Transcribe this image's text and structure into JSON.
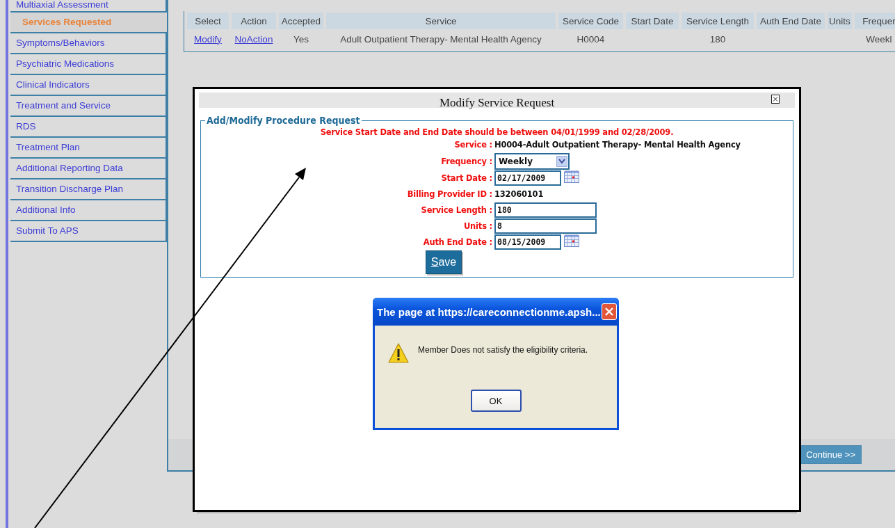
{
  "sidebar": {
    "items": [
      {
        "label": "Multiaxial Assessment",
        "selected": false
      },
      {
        "label": "Services Requested",
        "selected": true
      },
      {
        "label": "Symptoms/Behaviors",
        "selected": false
      },
      {
        "label": "Psychiatric Medications",
        "selected": false
      },
      {
        "label": "Clinical Indicators",
        "selected": false
      },
      {
        "label": "Treatment and Service",
        "selected": false
      },
      {
        "label": "RDS",
        "selected": false
      },
      {
        "label": "Treatment Plan",
        "selected": false
      },
      {
        "label": "Additional Reporting Data",
        "selected": false
      },
      {
        "label": "Transition Discharge Plan",
        "selected": false
      },
      {
        "label": "Additional Info",
        "selected": false
      },
      {
        "label": "Submit To APS",
        "selected": false
      }
    ]
  },
  "table": {
    "columns": [
      "Select",
      "Action",
      "Accepted",
      "Service",
      "Service Code",
      "Start Date",
      "Service Length",
      "Auth End Date",
      "Units",
      "Frequer"
    ],
    "rows": [
      {
        "cells": [
          {
            "text": "Modify",
            "kind": "link"
          },
          {
            "text": "NoAction",
            "kind": "link"
          },
          {
            "text": "Yes",
            "kind": "text"
          },
          {
            "text": "Adult Outpatient Therapy- Mental Health Agency",
            "kind": "text"
          },
          {
            "text": "H0004",
            "kind": "text"
          },
          null,
          {
            "text": "180",
            "kind": "text"
          },
          null,
          null,
          {
            "text": "Weekl",
            "kind": "text"
          }
        ]
      }
    ]
  },
  "continue_button": "Continue >>",
  "modal": {
    "title": "Modify Service Request",
    "section": "Add/Modify Procedure Request",
    "notice": "Service Start Date and End Date should be between 04/01/1999 and 02/28/2009.",
    "fields": [
      {
        "label": "Service :",
        "value": "H0004-Adult Outpatient Therapy- Mental Health Agency",
        "kind": "text"
      },
      {
        "label": "Frequency :",
        "value": "Weekly",
        "kind": "select"
      },
      {
        "label": "Start Date :",
        "value": "02/17/2009",
        "kind": "date"
      },
      {
        "label": "Billing Provider ID :",
        "value": "132060101",
        "kind": "text"
      },
      {
        "label": "Service Length :",
        "value": "180",
        "kind": "input"
      },
      {
        "label": "Units :",
        "value": "8",
        "kind": "input"
      },
      {
        "label": "Auth End Date :",
        "value": "08/15/2009",
        "kind": "date"
      }
    ],
    "save_button": "Save"
  },
  "alert": {
    "title": "The page at https://careconnectionme.apsh...",
    "message": "Member Does not satisfy the eligibility criteria.",
    "ok_button": "OK"
  }
}
